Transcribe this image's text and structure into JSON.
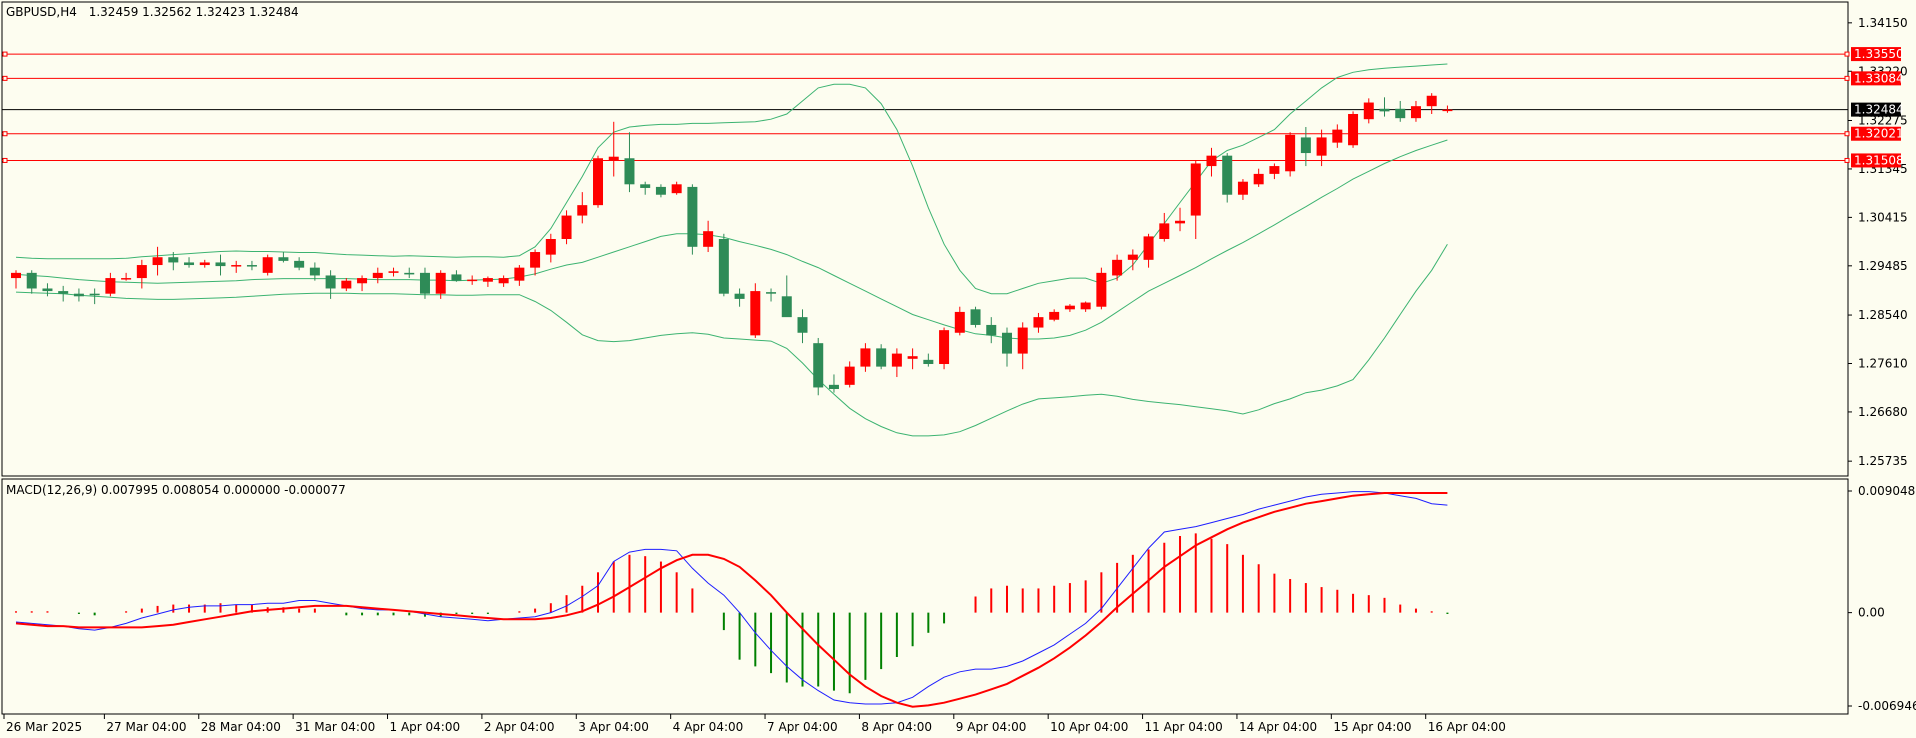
{
  "window": {
    "info_symbol": "GBPUSD,H4",
    "info_ohlc": "1.32459 1.32562 1.32423 1.32484",
    "macd_label": "MACD(12,26,9) 0.007995 0.008054 0.000000 -0.000077"
  },
  "colors": {
    "background": "#fdfdf0",
    "bull": "#ff0000",
    "bear": "#2e8b57",
    "bands": "#3cb371",
    "macd_line": "#1e1eff",
    "signal_line": "#ff0000",
    "hist_pos": "#ff0000",
    "hist_neg": "#008000",
    "level_line": "#ff0000",
    "price_line": "#000000"
  },
  "chart_data": {
    "type": "candlestick",
    "symbol": "GBPUSD",
    "timeframe": "H4",
    "price_axis": {
      "min": 1.2545,
      "max": 1.3455,
      "ticks": [
        "1.34150",
        "1.33220",
        "1.32275",
        "1.31345",
        "1.30415",
        "1.29485",
        "1.28540",
        "1.27610",
        "1.26680",
        "1.25735"
      ]
    },
    "price_levels": [
      {
        "label": "1.33550",
        "value": 1.3355
      },
      {
        "label": "1.33084",
        "value": 1.33084
      },
      {
        "label": "1.32021",
        "value": 1.32021
      },
      {
        "label": "1.31508",
        "value": 1.31508
      }
    ],
    "current_price": {
      "label": "1.32484",
      "value": 1.32484
    },
    "x_labels": [
      "26 Mar 2025",
      "27 Mar 04:00",
      "28 Mar 04:00",
      "31 Mar 04:00",
      "1 Apr 04:00",
      "2 Apr 04:00",
      "3 Apr 04:00",
      "4 Apr 04:00",
      "7 Apr 04:00",
      "8 Apr 04:00",
      "9 Apr 04:00",
      "10 Apr 04:00",
      "11 Apr 04:00",
      "14 Apr 04:00",
      "15 Apr 04:00",
      "16 Apr 04:00"
    ],
    "candles": [
      [
        1.2925,
        1.294,
        1.2905,
        1.2935
      ],
      [
        1.2935,
        1.294,
        1.2895,
        1.2905
      ],
      [
        1.2905,
        1.2915,
        1.289,
        1.29
      ],
      [
        1.29,
        1.291,
        1.288,
        1.2895
      ],
      [
        1.2895,
        1.2905,
        1.288,
        1.289
      ],
      [
        1.2895,
        1.2905,
        1.2875,
        1.2892
      ],
      [
        1.2895,
        1.2935,
        1.289,
        1.2925
      ],
      [
        1.2925,
        1.2935,
        1.292,
        1.2925
      ],
      [
        1.2925,
        1.296,
        1.2905,
        1.295
      ],
      [
        1.295,
        1.2985,
        1.293,
        1.2965
      ],
      [
        1.2965,
        1.2975,
        1.294,
        1.2955
      ],
      [
        1.2955,
        1.2965,
        1.2945,
        1.295
      ],
      [
        1.295,
        1.296,
        1.2945,
        1.2955
      ],
      [
        1.2955,
        1.297,
        1.293,
        1.2948
      ],
      [
        1.2948,
        1.2958,
        1.2935,
        1.295
      ],
      [
        1.295,
        1.2958,
        1.294,
        1.2948
      ],
      [
        1.2935,
        1.297,
        1.293,
        1.2965
      ],
      [
        1.2965,
        1.2975,
        1.2955,
        1.2958
      ],
      [
        1.2958,
        1.2965,
        1.294,
        1.2945
      ],
      [
        1.2945,
        1.2955,
        1.292,
        1.293
      ],
      [
        1.293,
        1.294,
        1.2885,
        1.2905
      ],
      [
        1.2905,
        1.2925,
        1.29,
        1.292
      ],
      [
        1.2915,
        1.293,
        1.29,
        1.2925
      ],
      [
        1.2925,
        1.2945,
        1.2915,
        1.2935
      ],
      [
        1.2935,
        1.2945,
        1.2928,
        1.2938
      ],
      [
        1.2935,
        1.2945,
        1.2925,
        1.2932
      ],
      [
        1.2935,
        1.2945,
        1.2885,
        1.2895
      ],
      [
        1.2895,
        1.294,
        1.2885,
        1.2935
      ],
      [
        1.2932,
        1.294,
        1.2918,
        1.292
      ],
      [
        1.292,
        1.293,
        1.2912,
        1.2922
      ],
      [
        1.2918,
        1.2928,
        1.2908,
        1.2925
      ],
      [
        1.2915,
        1.293,
        1.2908,
        1.2925
      ],
      [
        1.292,
        1.295,
        1.291,
        1.2945
      ],
      [
        1.2945,
        1.298,
        1.293,
        1.2975
      ],
      [
        1.297,
        1.301,
        1.2955,
        1.3
      ],
      [
        1.3,
        1.3055,
        1.299,
        1.3045
      ],
      [
        1.3045,
        1.309,
        1.303,
        1.3065
      ],
      [
        1.3065,
        1.316,
        1.306,
        1.3155
      ],
      [
        1.315,
        1.3225,
        1.312,
        1.3158
      ],
      [
        1.3155,
        1.3205,
        1.309,
        1.3105
      ],
      [
        1.3105,
        1.311,
        1.3085,
        1.3098
      ],
      [
        1.31,
        1.3105,
        1.308,
        1.3085
      ],
      [
        1.3088,
        1.311,
        1.3085,
        1.3105
      ],
      [
        1.31,
        1.3105,
        1.297,
        1.2985
      ],
      [
        1.2985,
        1.3035,
        1.2975,
        1.3015
      ],
      [
        1.3,
        1.301,
        1.289,
        1.2895
      ],
      [
        1.2895,
        1.2905,
        1.287,
        1.2885
      ],
      [
        1.2815,
        1.2915,
        1.281,
        1.29
      ],
      [
        1.2898,
        1.2905,
        1.288,
        1.2895
      ],
      [
        1.289,
        1.293,
        1.286,
        1.285
      ],
      [
        1.285,
        1.2865,
        1.28,
        1.282
      ],
      [
        1.28,
        1.281,
        1.27,
        1.2715
      ],
      [
        1.272,
        1.274,
        1.2705,
        1.2712
      ],
      [
        1.272,
        1.2765,
        1.2715,
        1.2755
      ],
      [
        1.2755,
        1.28,
        1.2745,
        1.279
      ],
      [
        1.279,
        1.2798,
        1.275,
        1.2755
      ],
      [
        1.2755,
        1.279,
        1.2735,
        1.278
      ],
      [
        1.277,
        1.279,
        1.275,
        1.2775
      ],
      [
        1.2768,
        1.278,
        1.2755,
        1.276
      ],
      [
        1.276,
        1.283,
        1.275,
        1.2825
      ],
      [
        1.282,
        1.287,
        1.2815,
        1.286
      ],
      [
        1.2865,
        1.287,
        1.283,
        1.2835
      ],
      [
        1.2835,
        1.285,
        1.28,
        1.2815
      ],
      [
        1.282,
        1.283,
        1.2755,
        1.278
      ],
      [
        1.278,
        1.284,
        1.275,
        1.283
      ],
      [
        1.283,
        1.2858,
        1.282,
        1.285
      ],
      [
        1.2845,
        1.2865,
        1.2842,
        1.286
      ],
      [
        1.2865,
        1.2875,
        1.286,
        1.2872
      ],
      [
        1.2865,
        1.288,
        1.286,
        1.2878
      ],
      [
        1.287,
        1.2945,
        1.2865,
        1.2935
      ],
      [
        1.293,
        1.297,
        1.292,
        1.296
      ],
      [
        1.296,
        1.298,
        1.294,
        1.297
      ],
      [
        1.296,
        1.301,
        1.2945,
        1.3005
      ],
      [
        1.3,
        1.305,
        1.2995,
        1.303
      ],
      [
        1.303,
        1.306,
        1.3015,
        1.3035
      ],
      [
        1.3045,
        1.315,
        1.3,
        1.3145
      ],
      [
        1.314,
        1.3175,
        1.312,
        1.316
      ],
      [
        1.316,
        1.3165,
        1.307,
        1.3085
      ],
      [
        1.3085,
        1.3115,
        1.3075,
        1.311
      ],
      [
        1.3105,
        1.3135,
        1.31,
        1.3125
      ],
      [
        1.3125,
        1.3145,
        1.3115,
        1.314
      ],
      [
        1.313,
        1.3205,
        1.312,
        1.32
      ],
      [
        1.3195,
        1.3215,
        1.314,
        1.3165
      ],
      [
        1.316,
        1.321,
        1.314,
        1.3195
      ],
      [
        1.3185,
        1.322,
        1.3175,
        1.321
      ],
      [
        1.318,
        1.3245,
        1.3175,
        1.324
      ],
      [
        1.323,
        1.327,
        1.3222,
        1.3262
      ],
      [
        1.325,
        1.3272,
        1.3235,
        1.3245
      ],
      [
        1.325,
        1.3265,
        1.3225,
        1.3232
      ],
      [
        1.3232,
        1.3265,
        1.3225,
        1.3255
      ],
      [
        1.3255,
        1.328,
        1.324,
        1.3275
      ],
      [
        1.32459,
        1.32562,
        1.32423,
        1.32484
      ]
    ],
    "bollinger": {
      "upper": [
        1.2965,
        1.2963,
        1.2962,
        1.2962,
        1.2962,
        1.2962,
        1.2962,
        1.2963,
        1.2966,
        1.2968,
        1.297,
        1.2972,
        1.2974,
        1.2976,
        1.2977,
        1.2976,
        1.2976,
        1.2975,
        1.2974,
        1.2974,
        1.2972,
        1.297,
        1.2969,
        1.2968,
        1.2967,
        1.2968,
        1.2967,
        1.2966,
        1.2965,
        1.2966,
        1.2966,
        1.2965,
        1.2968,
        1.2985,
        1.302,
        1.307,
        1.312,
        1.3175,
        1.3205,
        1.3215,
        1.3218,
        1.322,
        1.322,
        1.3222,
        1.3222,
        1.3223,
        1.3224,
        1.3225,
        1.323,
        1.324,
        1.3265,
        1.329,
        1.3297,
        1.3297,
        1.329,
        1.326,
        1.321,
        1.314,
        1.306,
        1.299,
        1.294,
        1.2905,
        1.2895,
        1.2895,
        1.2905,
        1.2915,
        1.292,
        1.2925,
        1.2925,
        1.2915,
        1.2925,
        1.295,
        1.299,
        1.303,
        1.307,
        1.311,
        1.315,
        1.317,
        1.318,
        1.3195,
        1.321,
        1.324,
        1.3265,
        1.329,
        1.331,
        1.332,
        1.3325,
        1.3328,
        1.333,
        1.3332,
        1.3334,
        1.3336
      ],
      "middle": [
        1.2932,
        1.293,
        1.2928,
        1.2925,
        1.2922,
        1.292,
        1.2918,
        1.2917,
        1.2916,
        1.2915,
        1.2916,
        1.2917,
        1.2918,
        1.2919,
        1.292,
        1.2922,
        1.2923,
        1.2924,
        1.2924,
        1.2924,
        1.2924,
        1.2924,
        1.2923,
        1.2922,
        1.2922,
        1.2922,
        1.2921,
        1.2921,
        1.292,
        1.2921,
        1.2922,
        1.2923,
        1.2927,
        1.2933,
        1.2942,
        1.295,
        1.2955,
        1.2965,
        1.2975,
        1.2985,
        1.2995,
        1.3005,
        1.301,
        1.301,
        1.3008,
        1.3003,
        1.2995,
        1.2988,
        1.298,
        1.297,
        1.2957,
        1.2945,
        1.293,
        1.2915,
        1.29,
        1.2885,
        1.287,
        1.2855,
        1.2845,
        1.2835,
        1.2826,
        1.2818,
        1.2815,
        1.281,
        1.2808,
        1.2808,
        1.281,
        1.2815,
        1.2825,
        1.284,
        1.286,
        1.288,
        1.29,
        1.2915,
        1.293,
        1.2945,
        1.2962,
        1.2978,
        1.2993,
        1.301,
        1.3027,
        1.3045,
        1.3062,
        1.308,
        1.3097,
        1.3115,
        1.313,
        1.3145,
        1.3158,
        1.317,
        1.318,
        1.319
      ],
      "lower": [
        1.2898,
        1.2897,
        1.2896,
        1.2895,
        1.2892,
        1.289,
        1.2888,
        1.2886,
        1.2885,
        1.2884,
        1.2884,
        1.2885,
        1.2886,
        1.2887,
        1.2888,
        1.289,
        1.2892,
        1.2894,
        1.2895,
        1.2896,
        1.2896,
        1.2896,
        1.2895,
        1.2895,
        1.2895,
        1.2894,
        1.2893,
        1.2893,
        1.2892,
        1.2892,
        1.2893,
        1.2893,
        1.2893,
        1.288,
        1.2863,
        1.284,
        1.2816,
        1.2805,
        1.2803,
        1.2805,
        1.281,
        1.2815,
        1.2818,
        1.282,
        1.2817,
        1.281,
        1.2808,
        1.2806,
        1.2804,
        1.279,
        1.2762,
        1.273,
        1.2702,
        1.2675,
        1.2655,
        1.264,
        1.2628,
        1.2622,
        1.2622,
        1.2624,
        1.263,
        1.2642,
        1.2656,
        1.267,
        1.2683,
        1.2693,
        1.2695,
        1.2697,
        1.27,
        1.2702,
        1.2698,
        1.2692,
        1.2688,
        1.2685,
        1.2682,
        1.2678,
        1.2674,
        1.267,
        1.2664,
        1.2672,
        1.2684,
        1.2693,
        1.2705,
        1.271,
        1.2718,
        1.273,
        1.2768,
        1.281,
        1.2855,
        1.29,
        1.294,
        1.299
      ]
    },
    "macd": {
      "axis": {
        "max": 0.009048,
        "min": -0.006946,
        "ticks": [
          "0.009048",
          "0.00",
          "-0.006946"
        ]
      },
      "histogram": [
        0.0001,
        0.0001,
        0.0001,
        0.0,
        -0.0001,
        -0.0002,
        0.0,
        0.0001,
        0.0003,
        0.0005,
        0.0006,
        0.0006,
        0.0006,
        0.0007,
        0.0006,
        0.0006,
        0.0004,
        0.0004,
        0.0003,
        0.0003,
        0.0,
        -0.0002,
        -0.0002,
        -0.0002,
        -0.0002,
        -0.0002,
        -0.0003,
        -0.0003,
        -0.0001,
        -0.0001,
        -0.0001,
        0.0,
        0.0001,
        0.0003,
        0.0007,
        0.0013,
        0.002,
        0.003,
        0.0038,
        0.0043,
        0.0042,
        0.0038,
        0.003,
        0.0018,
        0.0,
        -0.0013,
        -0.0035,
        -0.004,
        -0.0045,
        -0.0052,
        -0.0055,
        -0.0055,
        -0.0058,
        -0.006,
        -0.005,
        -0.0042,
        -0.0033,
        -0.0025,
        -0.0015,
        -0.0008,
        0.0,
        0.0012,
        0.0018,
        0.002,
        0.0018,
        0.0018,
        0.002,
        0.0022,
        0.0024,
        0.003,
        0.0037,
        0.0043,
        0.0047,
        0.0052,
        0.0057,
        0.0059,
        0.0055,
        0.0051,
        0.0043,
        0.0036,
        0.0029,
        0.0025,
        0.0022,
        0.0019,
        0.0017,
        0.0014,
        0.0013,
        0.0011,
        0.0006,
        0.0003,
        0.0001,
        -0.0001
      ],
      "macd_line": [
        -0.0007,
        -0.0008,
        -0.0009,
        -0.001,
        -0.0012,
        -0.0013,
        -0.0011,
        -0.0008,
        -0.0004,
        -0.0001,
        0.0002,
        0.0004,
        0.0005,
        0.0005,
        0.0006,
        0.0006,
        0.0007,
        0.0007,
        0.0009,
        0.0009,
        0.0007,
        0.0005,
        0.0003,
        0.0002,
        0.0002,
        0.0001,
        -0.0001,
        -0.0003,
        -0.0004,
        -0.0005,
        -0.0006,
        -0.0005,
        -0.0004,
        -0.0003,
        0.0,
        0.0005,
        0.0012,
        0.002,
        0.0038,
        0.0045,
        0.0047,
        0.0047,
        0.0046,
        0.0033,
        0.0022,
        0.0013,
        0.0,
        -0.0015,
        -0.0028,
        -0.004,
        -0.005,
        -0.0058,
        -0.0065,
        -0.0067,
        -0.0068,
        -0.0068,
        -0.0067,
        -0.0063,
        -0.0055,
        -0.0048,
        -0.0044,
        -0.0042,
        -0.0042,
        -0.004,
        -0.0036,
        -0.003,
        -0.0024,
        -0.0016,
        -0.0008,
        0.0003,
        0.0018,
        0.0033,
        0.0048,
        0.006,
        0.0062,
        0.0064,
        0.0067,
        0.007,
        0.0073,
        0.0077,
        0.008,
        0.0083,
        0.0086,
        0.0088,
        0.0089,
        0.009,
        0.009,
        0.0089,
        0.0087,
        0.0085,
        0.0081,
        0.008
      ],
      "signal_line": [
        -0.0008,
        -0.0009,
        -0.001,
        -0.001,
        -0.0011,
        -0.0011,
        -0.0011,
        -0.0011,
        -0.0011,
        -0.001,
        -0.0009,
        -0.0007,
        -0.0005,
        -0.0003,
        -0.0001,
        0.0001,
        0.0002,
        0.0003,
        0.0004,
        0.0005,
        0.0005,
        0.0005,
        0.0004,
        0.0003,
        0.0002,
        0.0001,
        0.0,
        -0.0001,
        -0.0002,
        -0.0003,
        -0.0004,
        -0.0005,
        -0.0005,
        -0.0005,
        -0.0004,
        -0.0002,
        0.0001,
        0.0006,
        0.0012,
        0.0019,
        0.0026,
        0.0033,
        0.0039,
        0.0043,
        0.0043,
        0.004,
        0.0034,
        0.0024,
        0.0013,
        0.0,
        -0.0012,
        -0.0024,
        -0.0035,
        -0.0046,
        -0.0055,
        -0.0062,
        -0.0067,
        -0.007,
        -0.0069,
        -0.0067,
        -0.0064,
        -0.0061,
        -0.0057,
        -0.0053,
        -0.0047,
        -0.0041,
        -0.0034,
        -0.0026,
        -0.0017,
        -0.0007,
        0.0004,
        0.0014,
        0.0024,
        0.0034,
        0.0042,
        0.005,
        0.0056,
        0.0062,
        0.0067,
        0.0071,
        0.0075,
        0.0078,
        0.0081,
        0.0083,
        0.0085,
        0.0087,
        0.0088,
        0.0089,
        0.0089,
        0.0089,
        0.0089,
        0.0089
      ]
    }
  }
}
